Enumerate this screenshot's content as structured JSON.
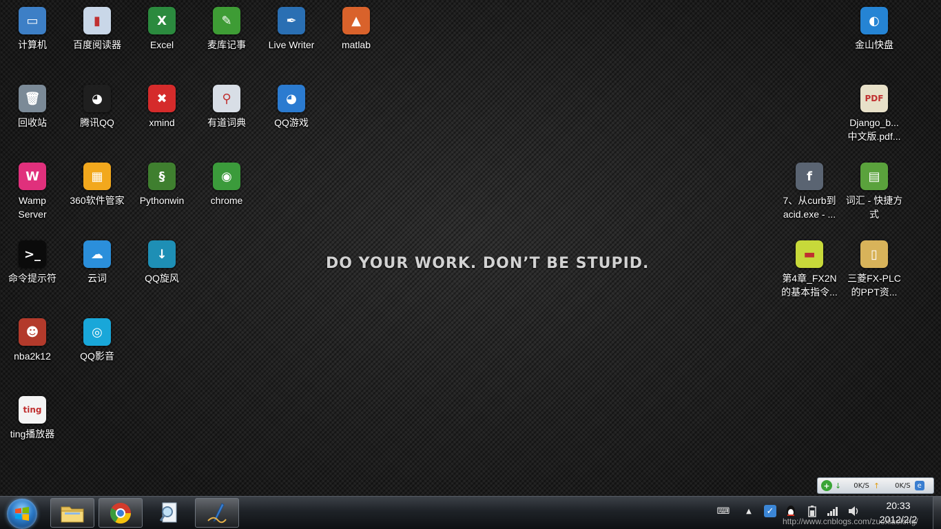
{
  "desktop": {
    "slogan": "DO YOUR WORK. DON’T BE STUPID.",
    "icons": [
      {
        "label": [
          "计算机"
        ],
        "glyph": "▭",
        "color": "#3d7fc6"
      },
      {
        "label": [
          "百度阅读器"
        ],
        "glyph": "▮",
        "color": "#c9d7e8"
      },
      {
        "label": [
          "Excel"
        ],
        "glyph": "X",
        "color": "#2b8a3e"
      },
      {
        "label": [
          "麦库记事"
        ],
        "glyph": "✎",
        "color": "#3e9c35"
      },
      {
        "label": [
          "Live Writer"
        ],
        "glyph": "✒",
        "color": "#2a6fb3"
      },
      {
        "label": [
          "matlab"
        ],
        "glyph": "▲",
        "color": "#d9622b"
      },
      {
        "label": [
          "回收站"
        ],
        "glyph": "🗑",
        "color": "#7b8a97"
      },
      {
        "label": [
          "腾讯QQ"
        ],
        "glyph": "◕",
        "color": "#1f1f1f"
      },
      {
        "label": [
          "xmind"
        ],
        "glyph": "✖",
        "color": "#d52b2b"
      },
      {
        "label": [
          "有道词典"
        ],
        "glyph": "⚲",
        "color": "#d8dee6"
      },
      {
        "label": [
          "QQ游戏"
        ],
        "glyph": "◕",
        "color": "#2b7bd0"
      },
      {
        "label": [
          "Wamp",
          "Server"
        ],
        "glyph": "W",
        "color": "#e0307c"
      },
      {
        "label": [
          "360软件管家"
        ],
        "glyph": "▦",
        "color": "#f2a81d"
      },
      {
        "label": [
          "Pythonwin"
        ],
        "glyph": "§",
        "color": "#3f7f2f"
      },
      {
        "label": [
          "chrome"
        ],
        "glyph": "◉",
        "color": "#3b9b3b"
      },
      {
        "label": [
          "命令提示符"
        ],
        "glyph": ">_",
        "color": "#0b0b0b"
      },
      {
        "label": [
          "云词"
        ],
        "glyph": "☁",
        "color": "#2b8fdb"
      },
      {
        "label": [
          "QQ旋风"
        ],
        "glyph": "↓",
        "color": "#1e8fb5"
      },
      {
        "label": [
          "nba2k12"
        ],
        "glyph": "☻",
        "color": "#b33a2b"
      },
      {
        "label": [
          "QQ影音"
        ],
        "glyph": "◎",
        "color": "#19a7d9"
      },
      {
        "label": [
          "ting播放器"
        ],
        "glyph": "ting",
        "color": "#f4f4f4"
      },
      {
        "label": [
          "金山快盘"
        ],
        "glyph": "◐",
        "color": "#2584d4"
      },
      {
        "label": [
          "Django_b...",
          "中文版.pdf..."
        ],
        "glyph": "PDF",
        "color": "#e8e1c9"
      },
      {
        "label": [
          "7、从curb到",
          "acid.exe - ..."
        ],
        "glyph": "f",
        "color": "#5a6472"
      },
      {
        "label": [
          "词汇 - 快捷方",
          "式"
        ],
        "glyph": "▤",
        "color": "#5aa23c"
      },
      {
        "label": [
          "第4章_FX2N",
          "的基本指令..."
        ],
        "glyph": "▬",
        "color": "#c7d93a"
      },
      {
        "label": [
          "三菱FX-PLC",
          "的PPT资..."
        ],
        "glyph": "▯",
        "color": "#d8b35a"
      }
    ]
  },
  "speed_widget": {
    "down_label": "0K/S",
    "up_label": "0K/S"
  },
  "taskbar": {
    "pinned": [
      "folder-icon",
      "chrome-icon",
      "search-doc-icon",
      "live-writer-icon"
    ],
    "clock_time": "20:33",
    "clock_date": "2012/2/2"
  },
  "watermark": "http://www.cnblogs.com/zuoxiaolong/"
}
